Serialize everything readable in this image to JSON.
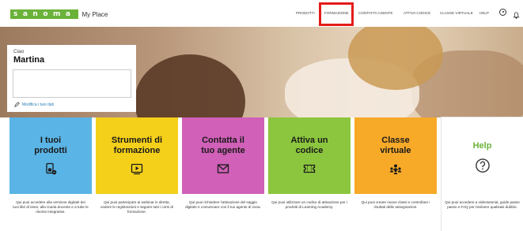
{
  "brand": {
    "logo_text": "sanoma",
    "suffix": "My Place",
    "logo_color": "#6ab23a"
  },
  "nav": {
    "items": [
      {
        "label": "PRODOTTI"
      },
      {
        "label": "FORMAZIONE"
      },
      {
        "label": "CONTATTA AGENTE"
      },
      {
        "label": "ATTIVA CODICE"
      },
      {
        "label": "CLASSE VIRTUALE"
      },
      {
        "label": "HELP"
      }
    ],
    "highlight_color": "#e41b1b"
  },
  "greeting": {
    "hello": "Ciao",
    "name": "Martina",
    "edit_link": "Modifica i tuoi dati"
  },
  "cards": [
    {
      "title_line1": "I tuoi",
      "title_line2": "prodotti",
      "icon": "book-tablet-icon",
      "color": "#5ab4e5",
      "description": "Qui puoi accedere alla versione digitale dei tuoi libri di testo, alla Guida docente e a tutte le risorse integrative."
    },
    {
      "title_line1": "Strumenti di",
      "title_line2": "formazione",
      "icon": "play-screen-icon",
      "color": "#f4d01a",
      "description": "Qui puoi partecipare ai webinar in diretta, vedere le registrazioni e seguire tutti i corsi di formazione."
    },
    {
      "title_line1": "Contatta il",
      "title_line2": "tuo agente",
      "icon": "mail-icon",
      "color": "#d060b8",
      "description": "Qui puoi richiedere l'attivazione del saggio digitale e comunicare con il tuo agente di zona."
    },
    {
      "title_line1": "Attiva un",
      "title_line2": "codice",
      "icon": "ticket-icon",
      "color": "#8cc63e",
      "description": "Qui puoi utilizzare un codice di attivazione per i prodotti di Learning Academy."
    },
    {
      "title_line1": "Classe",
      "title_line2": "virtuale",
      "icon": "class-group-icon",
      "color": "#f7a928",
      "description": "Qui puoi creare nuove classi e controllare i risultati delle assegnazioni."
    },
    {
      "title_line1": "Help",
      "title_line2": "",
      "icon": "question-circle-icon",
      "color": "#ffffff",
      "title_color": "#6ab23a",
      "description": "Qui puoi accedere a videotutorial, guide passo passo e FAQ per risolvere qualsiasi dubbio."
    }
  ]
}
